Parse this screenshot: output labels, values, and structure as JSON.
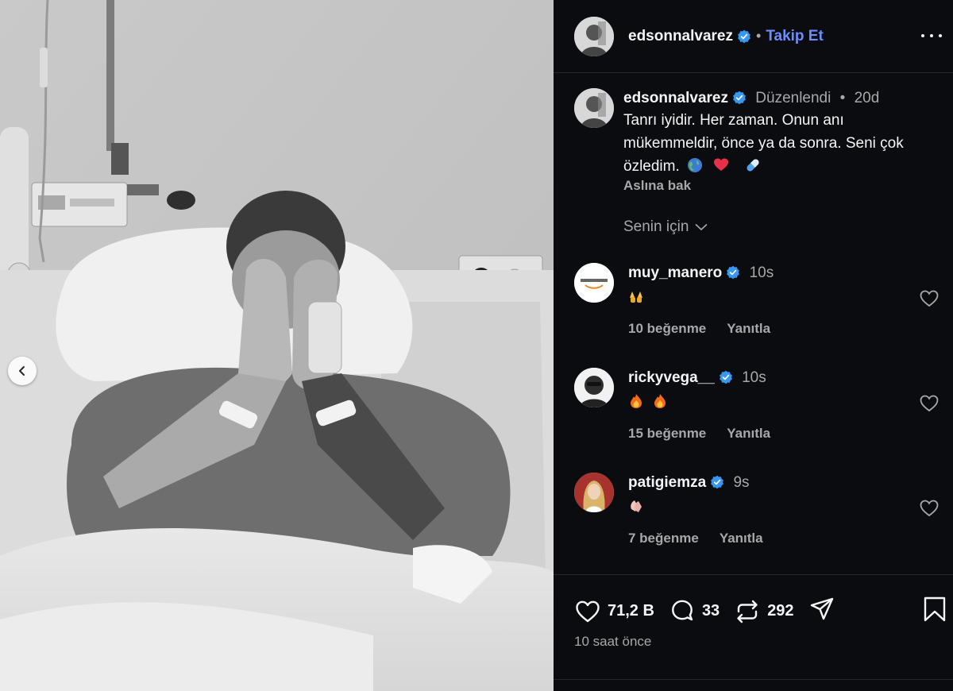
{
  "post": {
    "author": "edsonnalvarez",
    "follow_label": "Takip Et",
    "separator": "•",
    "caption": {
      "edited_label": "Düzenlendi",
      "separator": "•",
      "age": "20d",
      "text": "Tanrı iyidir. Her zaman. Onun anı mükemmeldir, önce ya da sonra. Seni çok özledim.",
      "emojis": [
        "globe-emoji",
        "red-heart-emoji",
        "pill-emoji"
      ],
      "see_translation": "Aslına bak"
    },
    "comment_sort": "Senin için",
    "comments": [
      {
        "user": "muy_manero",
        "time": "10s",
        "emojis": [
          "raising-hands-emoji"
        ],
        "likes": "10 beğenme",
        "reply": "Yanıtla"
      },
      {
        "user": "rickyvega__",
        "time": "10s",
        "emojis": [
          "fire-emoji",
          "fire-emoji"
        ],
        "likes": "15 beğenme",
        "reply": "Yanıtla"
      },
      {
        "user": "patigiemza",
        "time": "9s",
        "emojis": [
          "clapping-hands-emoji"
        ],
        "likes": "7 beğenme",
        "reply": "Yanıtla"
      }
    ],
    "stats": {
      "likes": "71,2 B",
      "comments": "33",
      "reposts": "292"
    },
    "posted_ago": "10 saat önce"
  },
  "colors": {
    "background": "#0b0c10",
    "text": "#f5f5f5",
    "muted": "#a8a8a8",
    "follow": "#6a8dff",
    "verified": "#3897f0",
    "divider": "#262626"
  },
  "icons": {
    "carousel_prev": "chevron-left-icon",
    "more": "more-options-icon",
    "like": "heart-icon",
    "comment": "comment-bubble-icon",
    "repost": "repost-icon",
    "share": "send-icon",
    "save": "bookmark-icon",
    "verified": "verified-badge-icon"
  }
}
